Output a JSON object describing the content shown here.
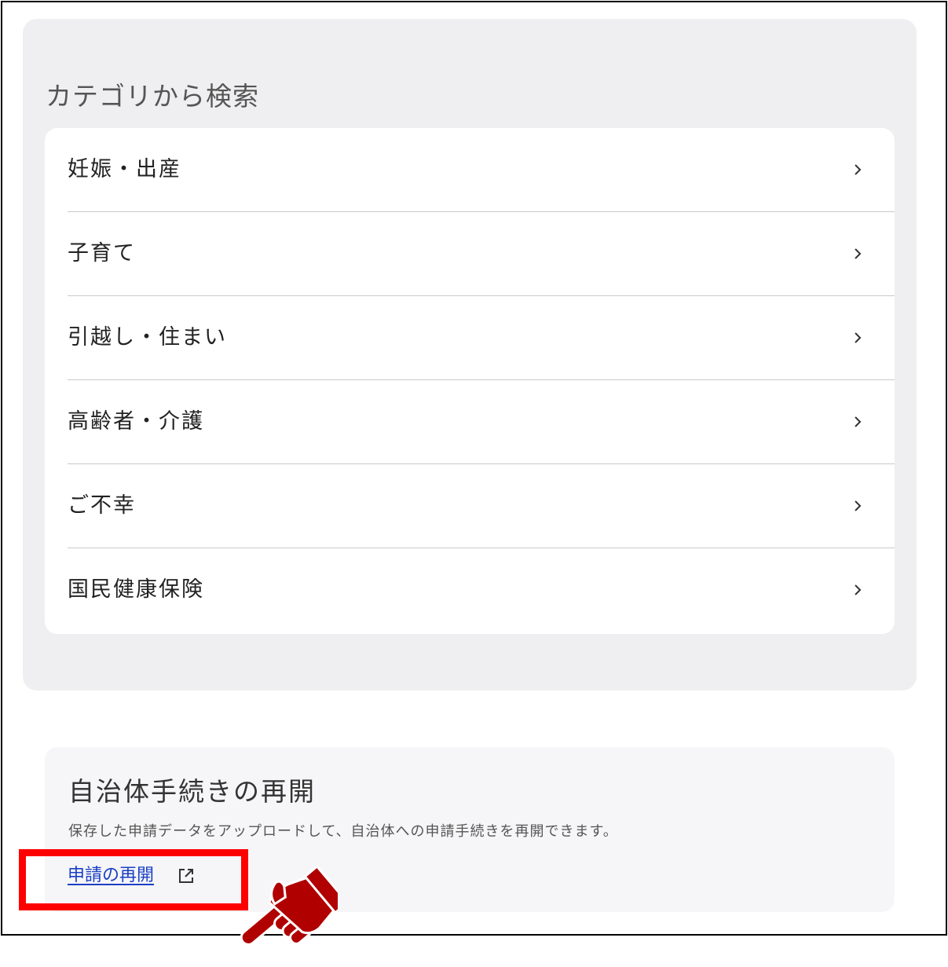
{
  "category_section": {
    "heading": "カテゴリから検索",
    "items": [
      {
        "label": "妊娠・出産"
      },
      {
        "label": "子育て"
      },
      {
        "label": "引越し・住まい"
      },
      {
        "label": "高齢者・介護"
      },
      {
        "label": "ご不幸"
      },
      {
        "label": "国民健康保険"
      }
    ]
  },
  "resume_section": {
    "heading": "自治体手続きの再開",
    "description": "保存した申請データをアップロードして、自治体への申請手続きを再開できます。",
    "link_label": "申請の再開",
    "link_icon": "external-link-icon"
  },
  "annotation": {
    "highlight_color": "#ff0000",
    "pointer_icon": "pointing-hand-icon",
    "pointer_color": "#b00000"
  },
  "colors": {
    "panel_background": "#efeff1",
    "link_color": "#1a3fc6"
  }
}
